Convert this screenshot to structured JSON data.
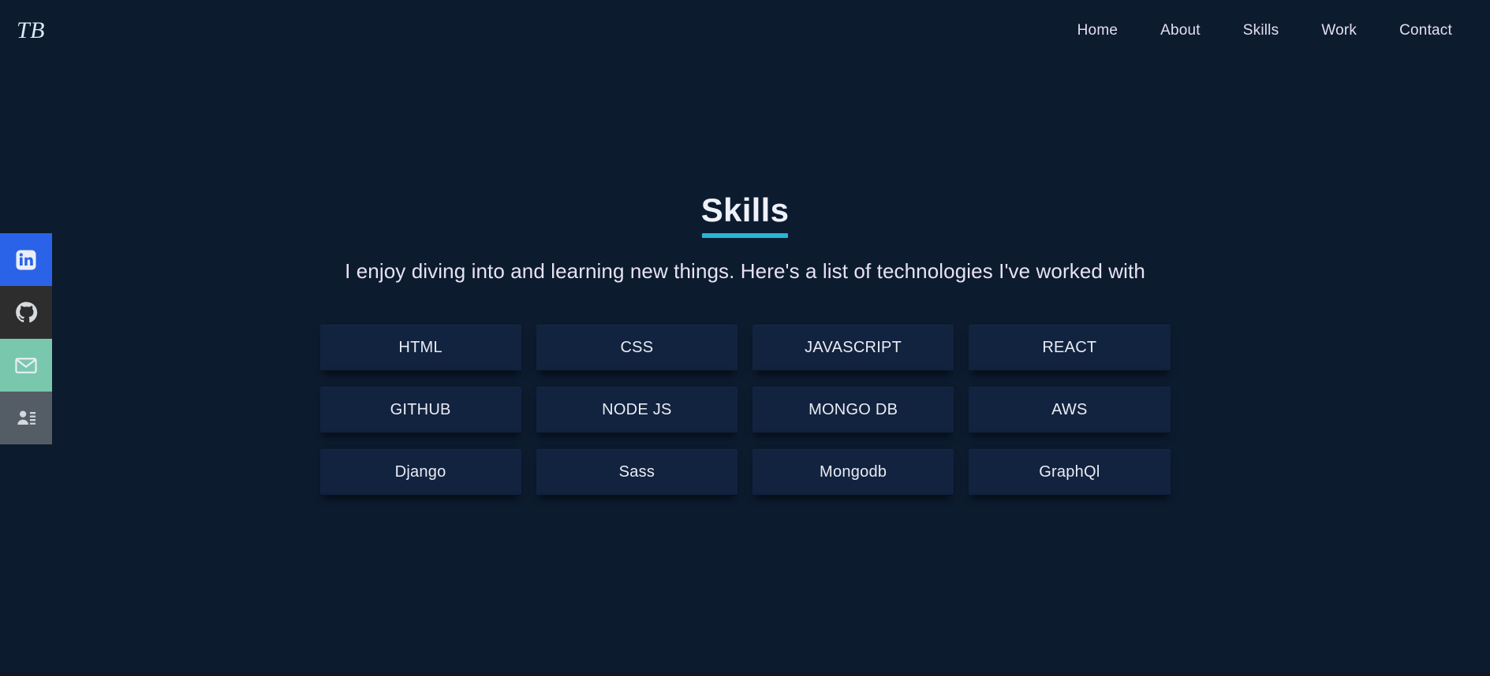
{
  "navbar": {
    "logo": "TB",
    "links": [
      {
        "label": "Home",
        "name": "nav-link-home"
      },
      {
        "label": "About",
        "name": "nav-link-about"
      },
      {
        "label": "Skills",
        "name": "nav-link-skills"
      },
      {
        "label": "Work",
        "name": "nav-link-work"
      },
      {
        "label": "Contact",
        "name": "nav-link-contact"
      }
    ]
  },
  "social_rail": {
    "items": [
      {
        "icon": "linkedin-icon",
        "label": "LinkedIn",
        "color": "#2a63e8"
      },
      {
        "icon": "github-icon",
        "label": "GitHub",
        "color": "#2d2d2d"
      },
      {
        "icon": "email-icon",
        "label": "Email",
        "color": "#79c8ad"
      },
      {
        "icon": "contact-card-icon",
        "label": "Contact Card",
        "color": "#545c65"
      }
    ]
  },
  "skills": {
    "title": "Skills",
    "subtitle": "I enjoy diving into and learning new things. Here's a list of technologies I've worked with",
    "accent_color": "#27b6d8",
    "background_color": "#0d1b2f",
    "card_color": "#12233f",
    "cards": [
      {
        "label": "HTML"
      },
      {
        "label": "CSS"
      },
      {
        "label": "JAVASCRIPT"
      },
      {
        "label": "REACT"
      },
      {
        "label": "GITHUB"
      },
      {
        "label": "NODE JS"
      },
      {
        "label": "MONGO DB"
      },
      {
        "label": "AWS"
      },
      {
        "label": "Django"
      },
      {
        "label": "Sass"
      },
      {
        "label": "Mongodb"
      },
      {
        "label": "GraphQl"
      }
    ]
  }
}
